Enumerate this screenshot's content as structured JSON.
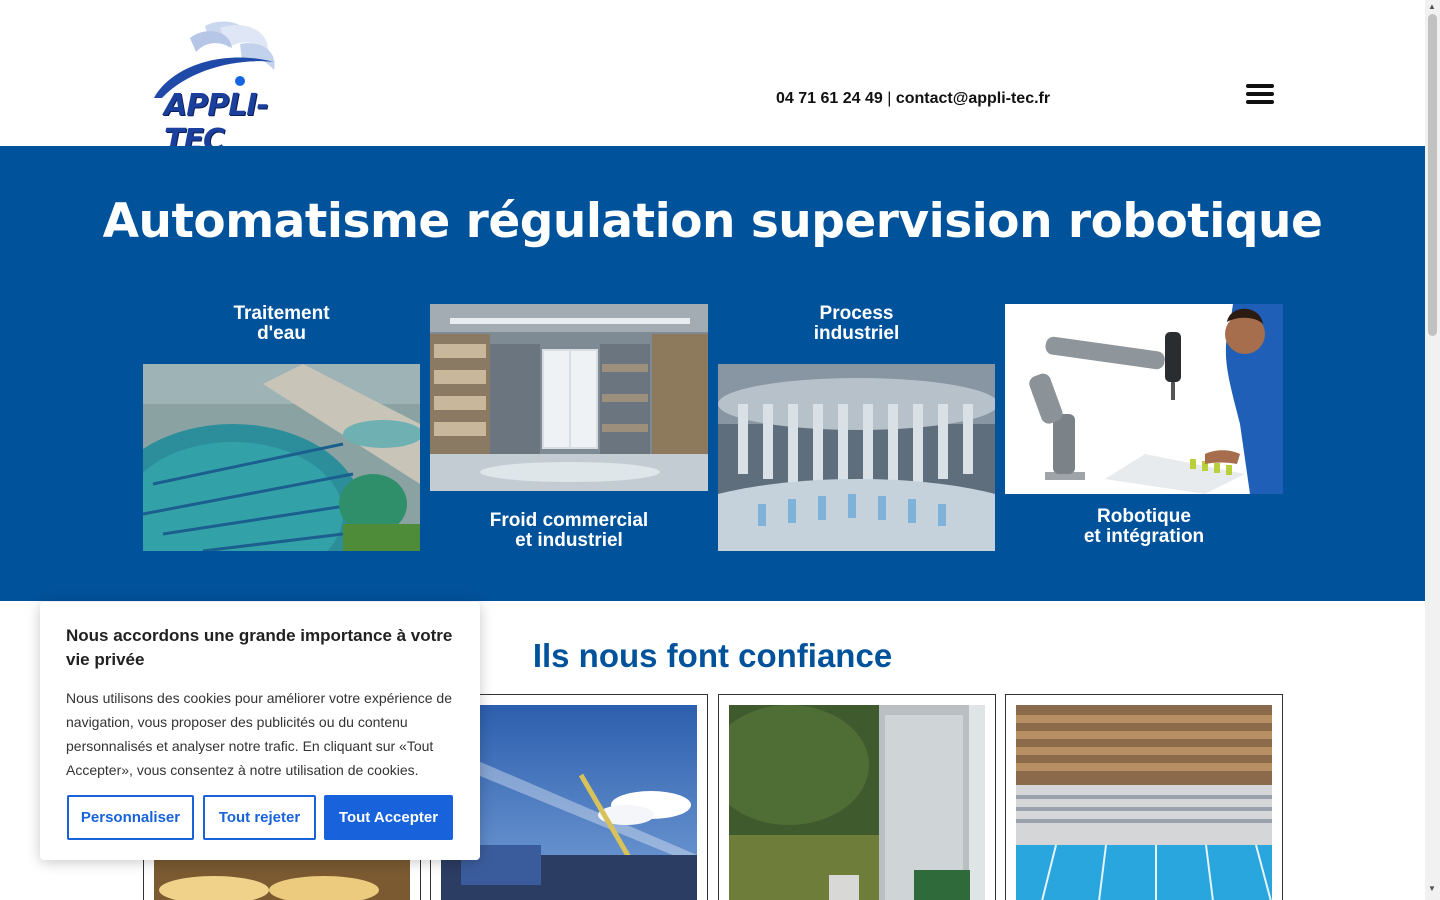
{
  "header": {
    "logo_text": "APPLI-TEC",
    "phone": "04 71 61 24 49",
    "separator": " | ",
    "email": "contact@appli-tec.fr"
  },
  "hero": {
    "title": "Automatisme régulation supervision robotique",
    "services": [
      {
        "line1": "Traitement",
        "line2": "d'eau"
      },
      {
        "line1": "Froid commercial",
        "line2": "et industriel"
      },
      {
        "line1": "Process",
        "line2": "industriel"
      },
      {
        "line1": "Robotique",
        "line2": "et intégration"
      }
    ]
  },
  "trust": {
    "title": "Ils nous font confiance"
  },
  "cookie": {
    "title": "Nous accordons une grande importance à votre vie privée",
    "body": "Nous utilisons des cookies pour améliorer votre expérience de navigation, vous proposer des publicités ou du contenu personnalisés et analyser notre trafic. En cliquant sur «Tout Accepter», vous consentez à notre utilisation de cookies.",
    "customize_label": "Personnaliser",
    "reject_label": "Tout rejeter",
    "accept_label": "Tout Accepter"
  },
  "colors": {
    "brand_blue": "#00529b",
    "button_blue": "#1863dc"
  }
}
